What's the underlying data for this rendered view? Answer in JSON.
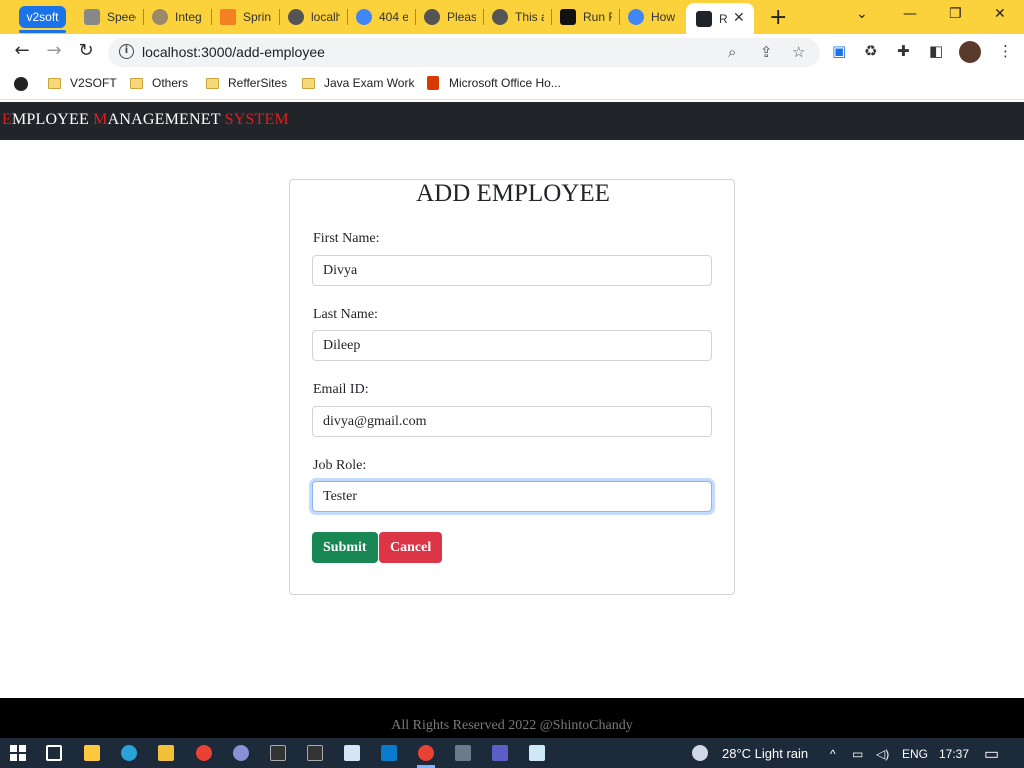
{
  "browser": {
    "tab_group": "v2soft",
    "tabs": [
      {
        "title": "Speed"
      },
      {
        "title": "Integ"
      },
      {
        "title": "Sprin"
      },
      {
        "title": "localh"
      },
      {
        "title": "404 e"
      },
      {
        "title": "Pleas"
      },
      {
        "title": "This a"
      },
      {
        "title": "Run F"
      },
      {
        "title": "How"
      },
      {
        "title": "R"
      }
    ],
    "url": "localhost:3000/add-employee",
    "bookmarks": [
      "V2SOFT",
      "Others",
      "RefferSites",
      "Java Exam Work",
      "Microsoft Office Ho..."
    ]
  },
  "navbar": {
    "brand_parts": [
      "E",
      "MPLOYEE ",
      "M",
      "ANAGEMENET ",
      "SYSTEM"
    ]
  },
  "form": {
    "title": "ADD EMPLOYEE",
    "fields": [
      {
        "label": "First Name:",
        "value": "Divya"
      },
      {
        "label": "Last Name:",
        "value": "Dileep"
      },
      {
        "label": "Email ID:",
        "value": "divya@gmail.com"
      },
      {
        "label": "Job Role:",
        "value": "Tester"
      }
    ],
    "submit_label": "Submit",
    "cancel_label": "Cancel"
  },
  "footer": {
    "text": "All Rights Reserved 2022 @ShintoChandy"
  },
  "taskbar": {
    "weather": "28°C  Light rain",
    "language": "ENG",
    "time": "17:37"
  },
  "colors": {
    "tabstrip": "#fbd23b",
    "navbar": "#212529",
    "brand_accent": "#e01e1e",
    "success": "#198754",
    "danger": "#dc3545"
  }
}
